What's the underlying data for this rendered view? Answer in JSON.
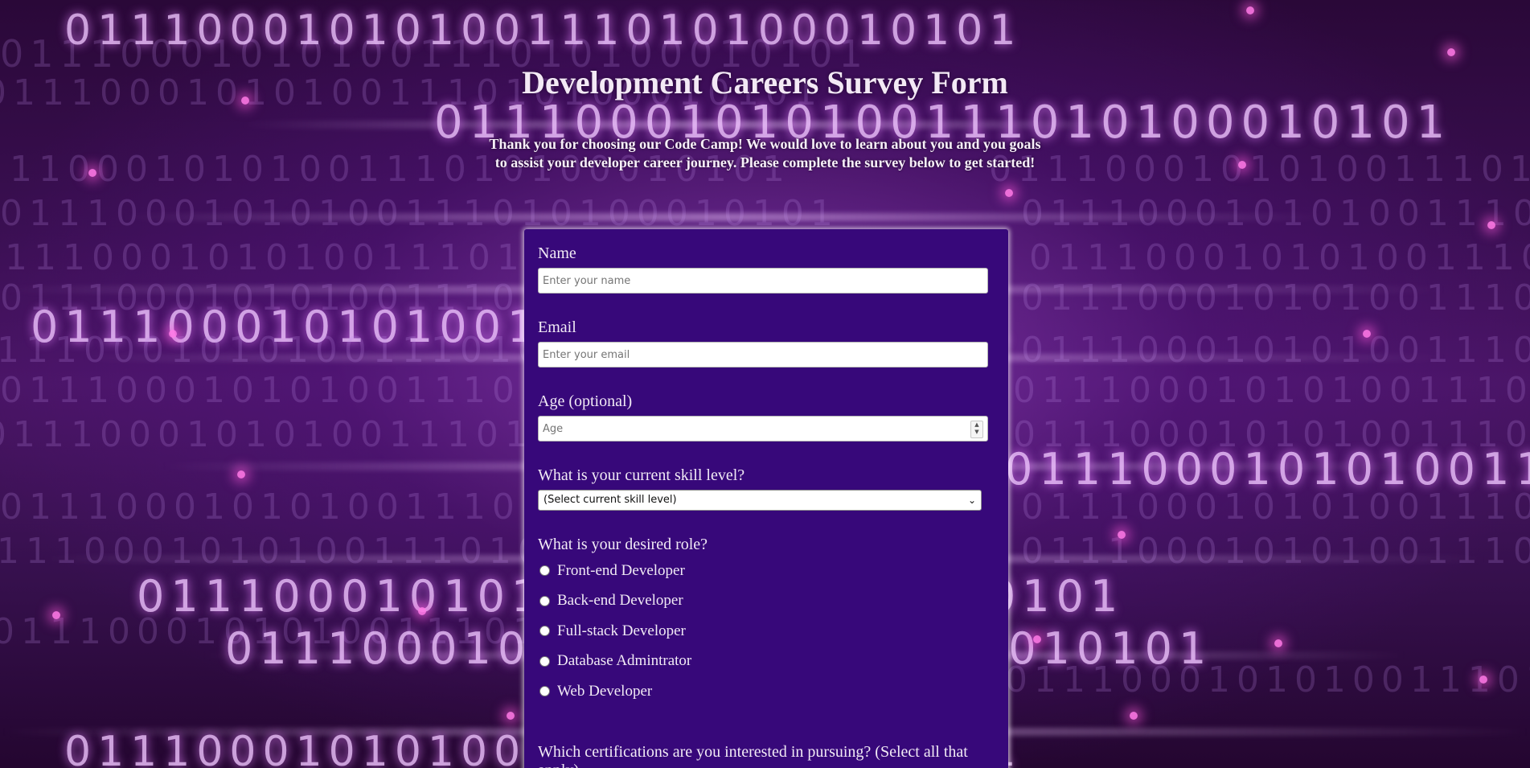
{
  "page": {
    "title": "Development Careers Survey Form",
    "intro": "Thank you for choosing our Code Camp! We would love to learn about you and you goals to assist your developer career journey. Please complete the survey below to get started!"
  },
  "form": {
    "name": {
      "label": "Name",
      "placeholder": "Enter your name",
      "value": ""
    },
    "email": {
      "label": "Email",
      "placeholder": "Enter your email",
      "value": ""
    },
    "age": {
      "label": "Age (optional)",
      "placeholder": "Age",
      "value": ""
    },
    "skill": {
      "label": "What is your current skill level?",
      "selected": "(Select current skill level)"
    },
    "role": {
      "label": "What is your desired role?",
      "options": [
        "Front-end Developer",
        "Back-end Developer",
        "Full-stack Developer",
        "Database Admintrator",
        "Web Developer"
      ]
    },
    "certifications": {
      "label": "Which certifications are you interested in pursuing? (Select all that apply)"
    }
  },
  "background": {
    "binary_text": "01110001010100111010100010101",
    "accent_color": "#37087a",
    "glow_color": "#e080ff"
  },
  "icons": {
    "select": "chevron-down-icon",
    "number": "spinner-arrows-icon",
    "radio": "radio-circle-icon"
  }
}
